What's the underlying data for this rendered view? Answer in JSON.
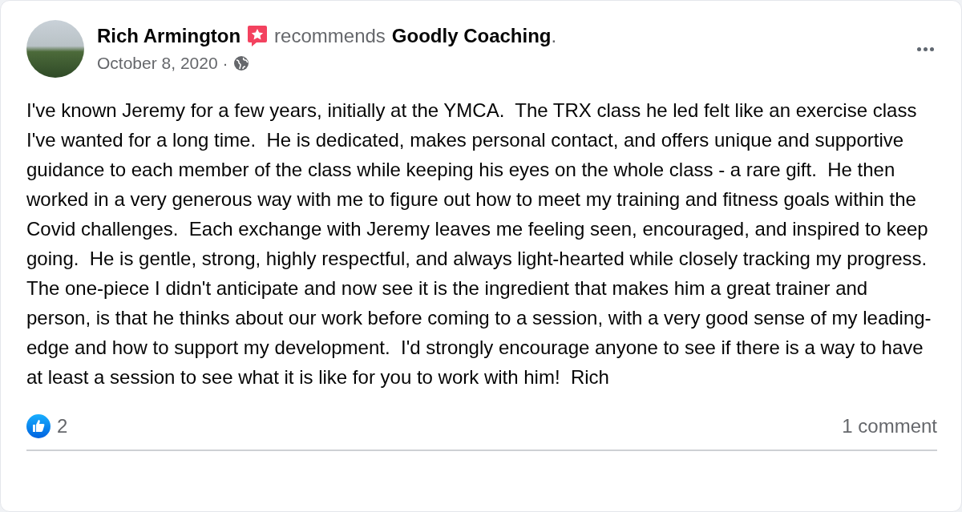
{
  "post": {
    "author": "Rich Armington",
    "verb": "recommends",
    "page": "Goodly Coaching",
    "punctuation": ".",
    "date": "October 8, 2020",
    "separator": "·",
    "body": "I've known Jeremy for a few years, initially at the YMCA.  The TRX class he led felt like an exercise class I've wanted for a long time.  He is dedicated, makes personal contact, and offers unique and supportive guidance to each member of the class while keeping his eyes on the whole class - a rare gift.  He then worked in a very generous way with me to figure out how to meet my training and fitness goals within the Covid challenges.  Each exchange with Jeremy leaves me feeling seen, encouraged, and inspired to keep going.  He is gentle, strong, highly respectful, and always light-hearted while closely tracking my progress.  The one-piece I didn't anticipate and now see it is the ingredient that makes him a great trainer and person, is that he thinks about our work before coming to a session, with a very good sense of my leading-edge and how to support my development.  I'd strongly encourage anyone to see if there is a way to have at least a session to see what it is like for you to work with him!  Rich",
    "likes": "2",
    "comments": "1 comment"
  }
}
